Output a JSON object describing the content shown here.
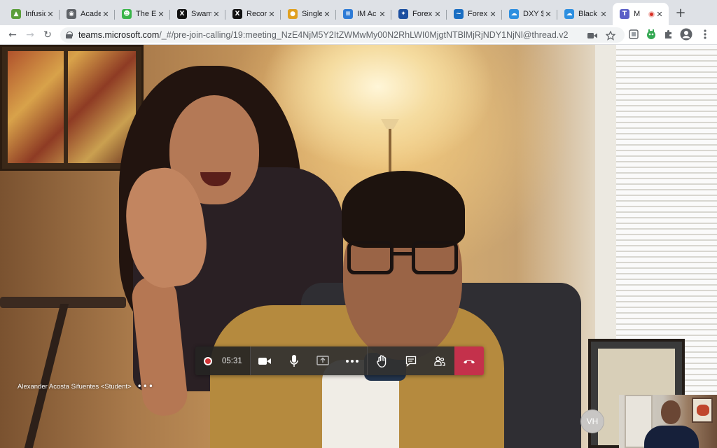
{
  "browser": {
    "tabs": [
      {
        "title": "Infusic",
        "fav_color": "#5a9e3a",
        "fav_glyph": "▲"
      },
      {
        "title": "Acade",
        "fav_color": "#5f6368",
        "fav_glyph": "◉"
      },
      {
        "title": "The El",
        "fav_color": "#3ab54a",
        "fav_glyph": "☻"
      },
      {
        "title": "Swam",
        "fav_color": "#111111",
        "fav_glyph": "X"
      },
      {
        "title": "Recor",
        "fav_color": "#111111",
        "fav_glyph": "X"
      },
      {
        "title": "Single",
        "fav_color": "#e0a020",
        "fav_glyph": "●"
      },
      {
        "title": "IM Ac",
        "fav_color": "#2e7bd6",
        "fav_glyph": "≡"
      },
      {
        "title": "Forex",
        "fav_color": "#1c4fa0",
        "fav_glyph": "✦"
      },
      {
        "title": "Forex",
        "fav_color": "#1a6ec2",
        "fav_glyph": "~"
      },
      {
        "title": "DXY $",
        "fav_color": "#2d8fe0",
        "fav_glyph": "☁"
      },
      {
        "title": "Black",
        "fav_color": "#2d8fe0",
        "fav_glyph": "☁"
      },
      {
        "title": "M",
        "fav_color": "#5b5fc7",
        "fav_glyph": "T",
        "active": true,
        "recording": true
      }
    ],
    "close_glyph": "✕",
    "new_tab_glyph": "+",
    "nav": {
      "back": "←",
      "forward": "→",
      "reload": "↻"
    },
    "url_domain": "teams.microsoft.com",
    "url_rest": "/_#/pre-join-calling/19:meeting_NzE4NjM5Y2ItZWMwMy00N2RhLWI0MjgtNTBlMjRjNDY1NjNl@thread.v2",
    "icons": [
      "video-camera-icon",
      "bookmark-star-icon",
      "extension-square-icon",
      "extension-green-icon",
      "puzzle-icon",
      "profile-icon",
      "menu-dots-icon"
    ]
  },
  "meeting": {
    "recording_time": "05:31",
    "participant_caption": "Alexander Acosta Sifuentes <Student>",
    "caption_more": "•••",
    "avatar_initials": "VH",
    "controls": [
      "video-camera-icon",
      "microphone-icon",
      "share-tray-icon",
      "more-actions-icon",
      "raise-hand-icon",
      "chat-icon",
      "participants-icon",
      "hang-up-icon"
    ],
    "hangup_color": "#c4314b"
  }
}
